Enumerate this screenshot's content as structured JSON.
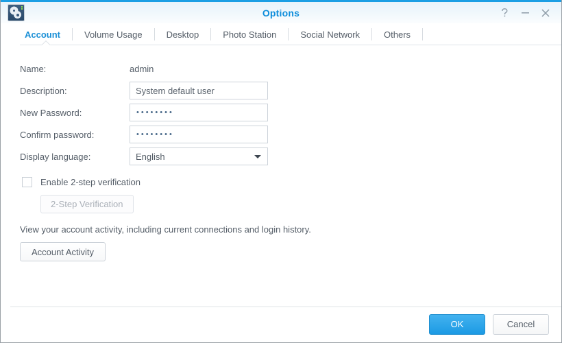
{
  "window": {
    "title": "Options",
    "app_icon": "control-panel-gears-icon",
    "accent_color": "#1b9ee4",
    "title_color": "#0d8ddb",
    "controls": [
      {
        "name": "help-icon",
        "glyph": "?"
      },
      {
        "name": "minimize-icon",
        "glyph": "–"
      },
      {
        "name": "close-icon",
        "glyph": "✕"
      }
    ]
  },
  "tabs": [
    {
      "label": "Account",
      "active": true
    },
    {
      "label": "Volume Usage",
      "active": false
    },
    {
      "label": "Desktop",
      "active": false
    },
    {
      "label": "Photo Station",
      "active": false
    },
    {
      "label": "Social Network",
      "active": false
    },
    {
      "label": "Others",
      "active": false
    }
  ],
  "form": {
    "name": {
      "label": "Name:",
      "value": "admin"
    },
    "description": {
      "label": "Description:",
      "value": "System default user",
      "placeholder": ""
    },
    "new_password": {
      "label": "New Password:",
      "value": "••••••••",
      "dot_count": 8
    },
    "confirm_password": {
      "label": "Confirm password:",
      "value": "••••••••",
      "dot_count": 8
    },
    "display_language": {
      "label": "Display language:",
      "value": "English"
    },
    "two_step_checkbox": {
      "label": "Enable 2-step verification",
      "checked": false
    },
    "two_step_button": {
      "label": "2-Step Verification",
      "disabled": true
    },
    "activity_description": "View your account activity, including current connections and login history.",
    "activity_button": {
      "label": "Account Activity"
    }
  },
  "footer": {
    "ok_label": "OK",
    "cancel_label": "Cancel",
    "ok_color": "#1c9ae4"
  }
}
